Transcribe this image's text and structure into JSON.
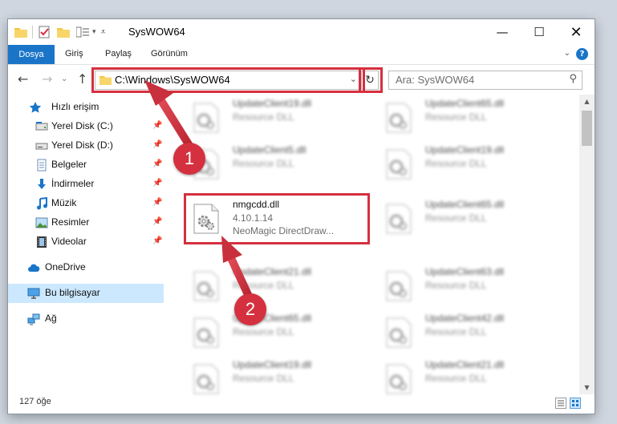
{
  "window": {
    "title": "SysWOW64"
  },
  "ribbon": {
    "tabs": [
      "Dosya",
      "Giriş",
      "Paylaş",
      "Görünüm"
    ]
  },
  "address": {
    "path": "C:\\Windows\\SysWOW64"
  },
  "search": {
    "placeholder": "Ara: SysWOW64"
  },
  "sidebar": {
    "items": [
      {
        "label": "Hızlı erişim",
        "icon": "star-icon"
      },
      {
        "label": "Yerel Disk (C:)",
        "icon": "drive-icon",
        "pinned": true
      },
      {
        "label": "Yerel Disk (D:)",
        "icon": "drive-icon",
        "pinned": true
      },
      {
        "label": "Belgeler",
        "icon": "documents-icon",
        "pinned": true
      },
      {
        "label": "İndirmeler",
        "icon": "download-icon",
        "pinned": true
      },
      {
        "label": "Müzik",
        "icon": "music-icon",
        "pinned": true
      },
      {
        "label": "Resimler",
        "icon": "pictures-icon",
        "pinned": true
      },
      {
        "label": "Videolar",
        "icon": "videos-icon",
        "pinned": true
      },
      {
        "label": "OneDrive",
        "icon": "cloud-icon"
      },
      {
        "label": "Bu bilgisayar",
        "icon": "computer-icon",
        "selected": true
      },
      {
        "label": "Ağ",
        "icon": "network-icon"
      }
    ]
  },
  "files": {
    "left": [
      {
        "name": "UpdateClient19.dll",
        "desc": "Resource DLL"
      },
      {
        "name": "UpdateClient5.dll",
        "desc": "Resource DLL"
      },
      {
        "name": "nmgcdd.dll",
        "version": "4.10.1.14",
        "desc": "NeoMagic DirectDraw..."
      },
      {
        "name": "UpdateClient21.dll",
        "desc": "Resource DLL"
      },
      {
        "name": "UpdateClient65.dll",
        "desc": "Resource DLL"
      },
      {
        "name": "UpdateClient19.dll",
        "desc": "Resource DLL"
      }
    ],
    "right": [
      {
        "name": "UpdateClient65.dll",
        "desc": "Resource DLL"
      },
      {
        "name": "UpdateClient19.dll",
        "desc": "Resource DLL"
      },
      {
        "name": "UpdateClient65.dll",
        "desc": "Resource DLL"
      },
      {
        "name": "UpdateClient63.dll",
        "desc": "Resource DLL"
      },
      {
        "name": "UpdateClient42.dll",
        "desc": "Resource DLL"
      },
      {
        "name": "UpdateClient21.dll",
        "desc": "Resource DLL"
      }
    ]
  },
  "status": {
    "count": "127 öğe"
  },
  "annotations": {
    "step1": "1",
    "step2": "2",
    "color": "#d5303f"
  },
  "colors": {
    "accent": "#1a75c9",
    "highlight": "#d5303f",
    "selected": "#cce8ff"
  }
}
